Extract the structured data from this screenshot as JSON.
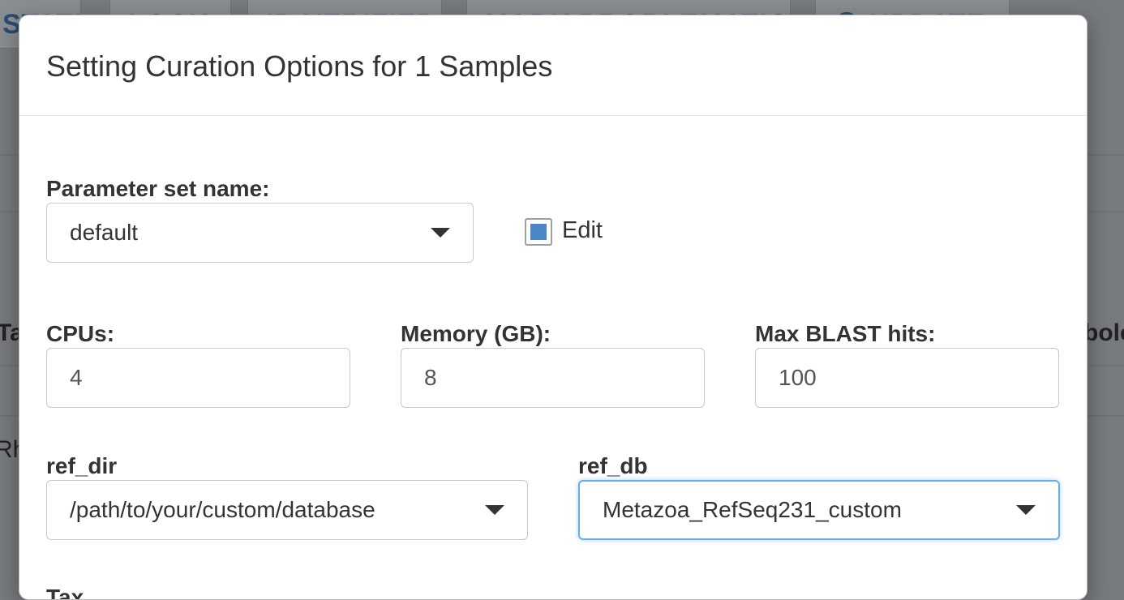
{
  "background": {
    "toolbar_buttons": [
      "STATE",
      "LOCK",
      "ID VERIFIED",
      "MARK PROBLEMATIC",
      "UPDATE"
    ],
    "left_fragments": [
      "Ta",
      "Rh"
    ],
    "right_fragment": "bolo"
  },
  "modal": {
    "title": "Setting Curation Options for 1 Samples",
    "parameter_set": {
      "label": "Parameter set name:",
      "value": "default",
      "edit_label": "Edit",
      "edit_checked": true
    },
    "cpus": {
      "label": "CPUs:",
      "value": "4"
    },
    "memory": {
      "label": "Memory (GB):",
      "value": "8"
    },
    "max_blast_hits": {
      "label": "Max BLAST hits:",
      "value": "100"
    },
    "ref_dir": {
      "label": "ref_dir",
      "value": "/path/to/your/custom/database"
    },
    "ref_db": {
      "label": "ref_db",
      "value": "Metazoa_RefSeq231_custom"
    },
    "next_label": "Tax..."
  },
  "colors": {
    "accent": "#4a86c8",
    "focus_border": "#66afe9",
    "backdrop": "#777a7e"
  }
}
